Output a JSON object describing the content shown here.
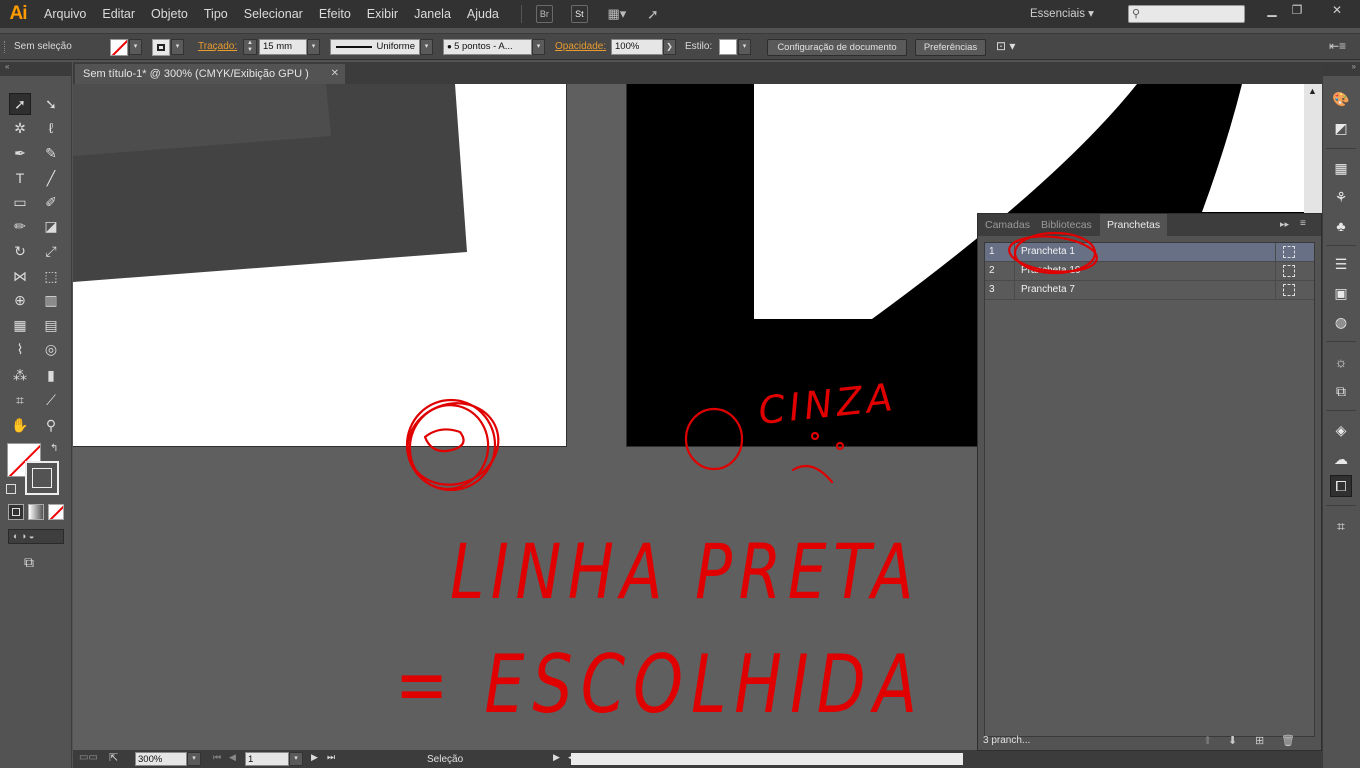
{
  "app": {
    "logo": "Ai"
  },
  "menu": {
    "items": [
      "Arquivo",
      "Editar",
      "Objeto",
      "Tipo",
      "Selecionar",
      "Efeito",
      "Exibir",
      "Janela",
      "Ajuda"
    ],
    "bridge_label": "Br",
    "stock_label": "St",
    "workspace": "Essenciais"
  },
  "control": {
    "selection": "Sem seleção",
    "stroke_label": "Traçado:",
    "stroke_weight": "15 mm",
    "stroke_profile": "Uniforme",
    "brush": "5 pontos - A...",
    "opacity_label": "Opacidade:",
    "opacity": "100%",
    "style_label": "Estilo:",
    "doc_setup": "Configuração de documento",
    "preferences": "Preferências"
  },
  "document": {
    "tab_title": "Sem título-1* @ 300% (CMYK/Exibição GPU )",
    "close": "✕"
  },
  "status": {
    "zoom": "300%",
    "artboard": "1",
    "tool": "Seleção"
  },
  "artboards_panel": {
    "tabs": [
      "Camadas",
      "Bibliotecas",
      "Pranchetas"
    ],
    "active_tab": "Pranchetas",
    "rows": [
      {
        "num": "1",
        "name": "Prancheta 1"
      },
      {
        "num": "2",
        "name": "Prancheta 10"
      },
      {
        "num": "3",
        "name": "Prancheta 7"
      }
    ],
    "count": "3 pranch..."
  },
  "annotations": {
    "word_gray": "CINZA",
    "line1": "LINHA PRETA",
    "line2": "= ESCOLHIDA",
    "color": "#e00000"
  },
  "colors": {
    "menubar": "#323232",
    "panel": "#535353",
    "canvas": "#5f5f5f",
    "accent_orange": "#ff9a00",
    "selected_row": "#687086"
  }
}
